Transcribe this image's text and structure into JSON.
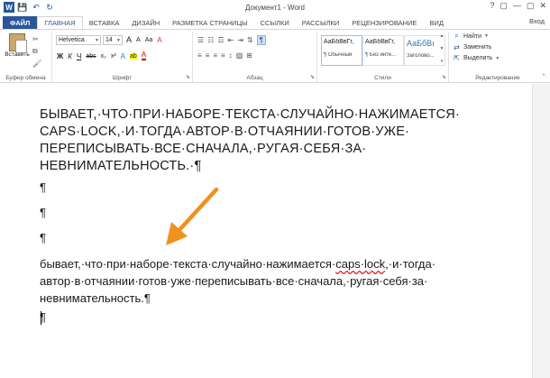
{
  "window": {
    "title": "Документ1 - Word",
    "user": "Вход",
    "controls": [
      "?",
      "▢",
      "—",
      "▢",
      "✕"
    ]
  },
  "qat": {
    "save": "💾",
    "undo": "↶",
    "redo": "↻"
  },
  "tabs": {
    "file": "ФАЙЛ",
    "items": [
      "ГЛАВНАЯ",
      "ВСТАВКА",
      "ДИЗАЙН",
      "РАЗМЕТКА СТРАНИЦЫ",
      "ССЫЛКИ",
      "РАССЫЛКИ",
      "РЕЦЕНЗИРОВАНИЕ",
      "ВИД"
    ]
  },
  "ribbon": {
    "clipboard": {
      "paste_label": "Вставить",
      "group_label": "Буфер обмена"
    },
    "font": {
      "family": "Helvetica",
      "size": "14",
      "grow": "A",
      "shrink": "A",
      "case": "Aa",
      "clear": "A",
      "bold": "Ж",
      "italic": "К",
      "underline": "Ч",
      "strike": "abc",
      "sub": "x₂",
      "sup": "x²",
      "effects": "A",
      "highlight": "ab",
      "color": "A",
      "group_label": "Шрифт"
    },
    "paragraph": {
      "pilcrow": "¶",
      "group_label": "Абзац"
    },
    "styles": {
      "cards": [
        {
          "sample": "АаБбВвГг,",
          "name": "¶ Обычный"
        },
        {
          "sample": "АаБбВвГг,",
          "name": "¶ Без инте..."
        },
        {
          "sample": "АаБбВı",
          "name": "Заголово..."
        }
      ],
      "group_label": "Стили"
    },
    "editing": {
      "find": "Найти",
      "replace": "Заменить",
      "select": "Выделить",
      "group_label": "Редактирование"
    }
  },
  "document": {
    "caps_paragraph": "БЫВАЕТ,·ЧТО·ПРИ·НАБОРЕ·ТЕКСТА·СЛУЧАЙНО·НАЖИМАЕТСЯ· CAPS·LOCK,·И·ТОГДА·АВТОР·В·ОТЧАЯНИИ·ГОТОВ·УЖЕ· ПЕРЕПИСЫВАТЬ·ВСЕ·СНАЧАЛА,·РУГАЯ·СЕБЯ·ЗА· НЕВНИМАТЕЛЬНОСТЬ.·¶",
    "empty_marks": [
      "¶",
      "¶",
      "¶"
    ],
    "lower_before": "бывает,·что·при·наборе·текста·случайно·нажимается·",
    "lower_spell": "caps·lock",
    "lower_after": ",·и·тогда· автор·в·отчаянии·готов·уже·переписывать·все·сначала,·ругая·себя·за· невнимательность.¶",
    "final_mark": "¶"
  },
  "colors": {
    "accent": "#2b579a",
    "arrow": "#f0901e"
  }
}
